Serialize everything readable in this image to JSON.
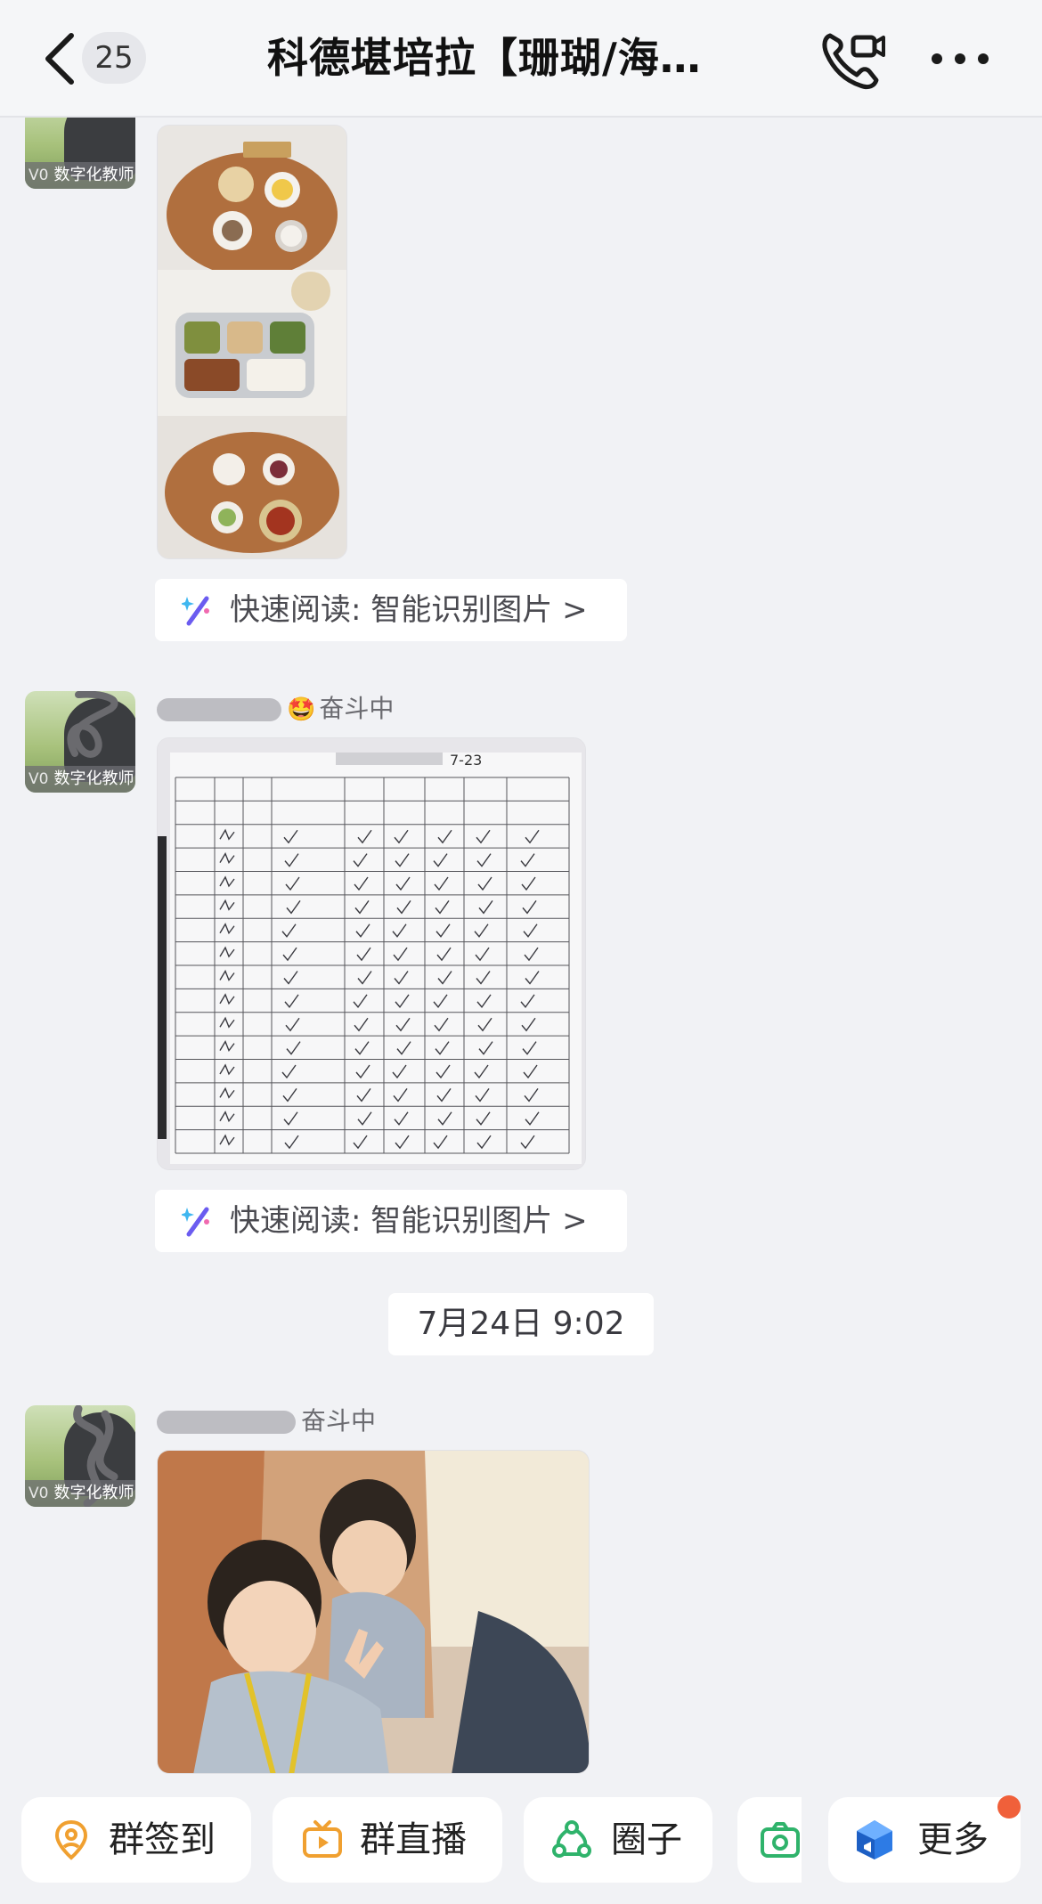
{
  "header": {
    "unread_count": "25",
    "title": "科德堪培拉【珊瑚/海…"
  },
  "messages": [
    {
      "avatar_tag_level": "V0",
      "avatar_tag_label": "数字化教师",
      "quick_read": "快速阅读: 智能识别图片 >"
    },
    {
      "avatar_tag_level": "V0",
      "avatar_tag_label": "数字化教师",
      "sender_status": "奋斗中",
      "sender_emoji": "🤩",
      "sheet_date": "7-23",
      "quick_read": "快速阅读: 智能识别图片 >"
    },
    {
      "avatar_tag_level": "V0",
      "avatar_tag_label": "数字化教师",
      "sender_status": "奋斗中"
    }
  ],
  "timestamp": "7月24日 9:02",
  "toolbar": {
    "items": [
      {
        "label": "群签到",
        "icon": "location-pin-icon",
        "color": "#f0a030"
      },
      {
        "label": "群直播",
        "icon": "tv-live-icon",
        "color": "#f0a030"
      },
      {
        "label": "圈子",
        "icon": "circle-share-icon",
        "color": "#2fb36b"
      },
      {
        "label": "",
        "icon": "camera-icon",
        "color": "#2fb36b"
      },
      {
        "label": "更多",
        "icon": "cube-icon",
        "color": "#2d7be5"
      }
    ]
  },
  "colors": {
    "background": "#f1f2f5",
    "notification_dot": "#f0603a"
  }
}
